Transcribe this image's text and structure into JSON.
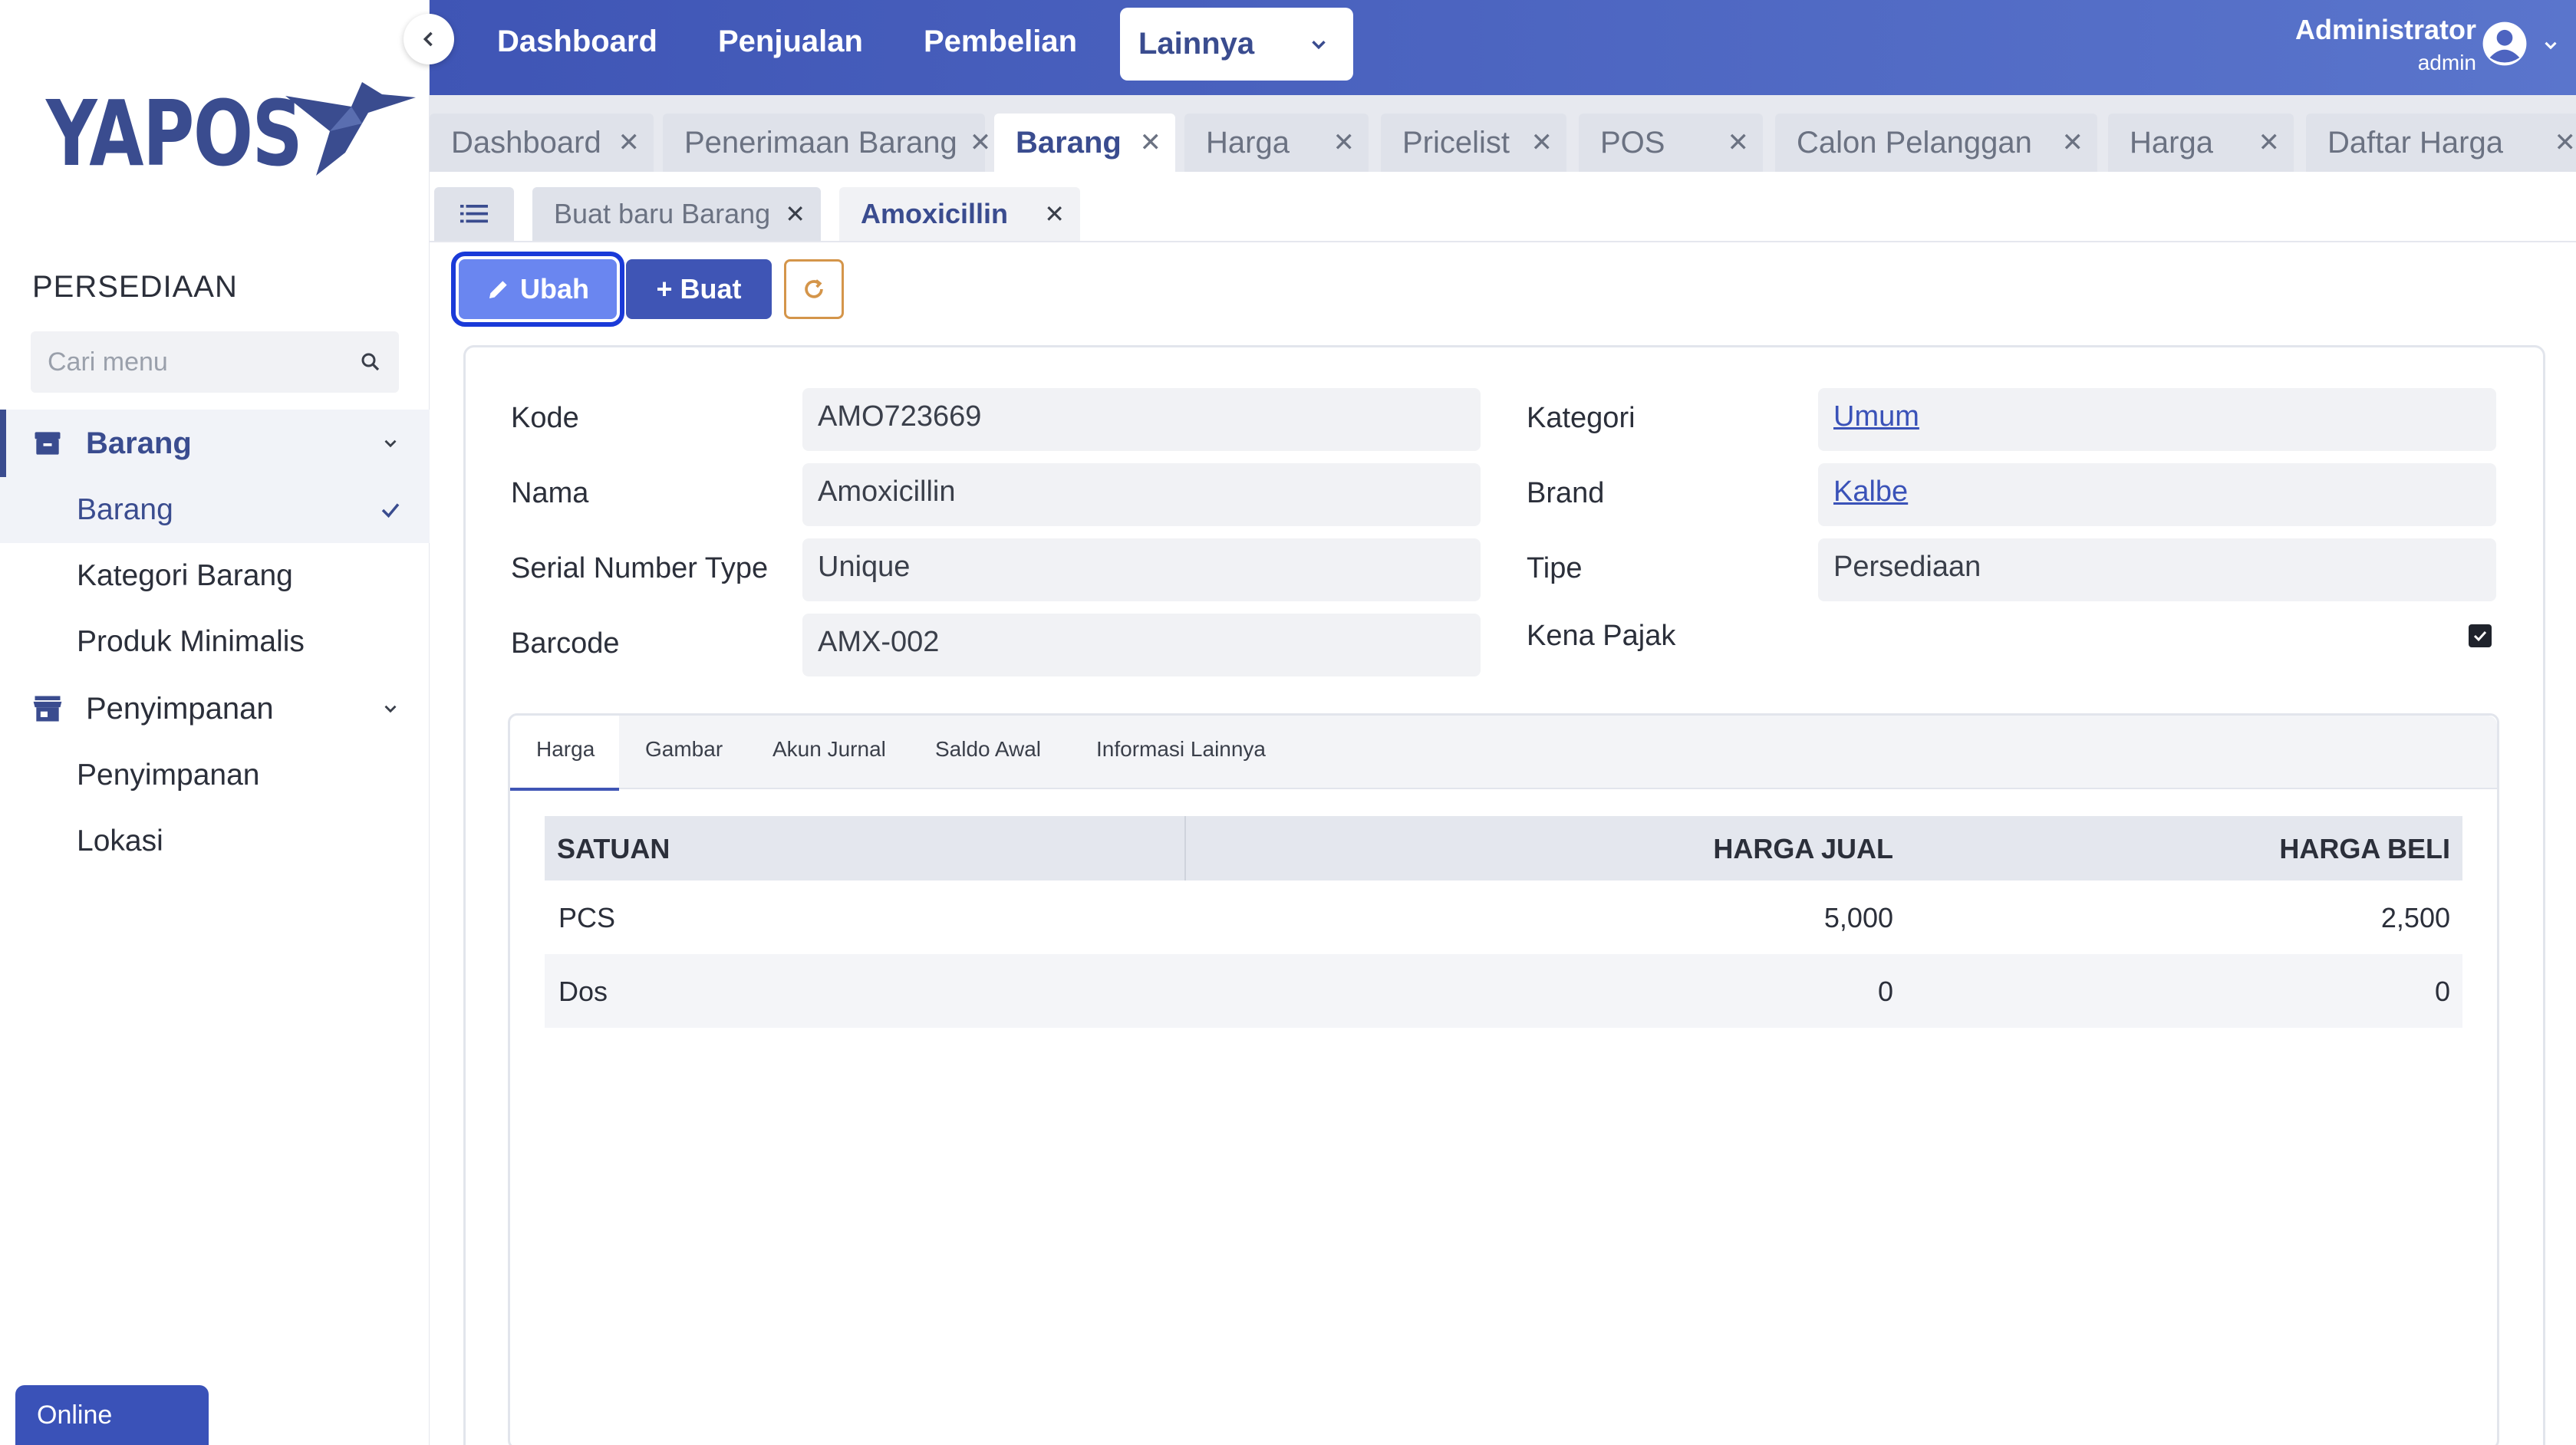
{
  "brand": {
    "name": "YAPOS",
    "color": "#3a4c8f"
  },
  "sidebar": {
    "section_title": "PERSEDIAAN",
    "search_placeholder": "Cari menu",
    "groups": [
      {
        "label": "Barang",
        "icon": "archive-icon",
        "items": [
          "Barang",
          "Kategori Barang",
          "Produk Minimalis"
        ]
      },
      {
        "label": "Penyimpanan",
        "icon": "store-icon",
        "items": [
          "Penyimpanan",
          "Lokasi"
        ]
      }
    ],
    "status": "Online"
  },
  "topnav": {
    "items": [
      "Dashboard",
      "Penjualan",
      "Pembelian"
    ],
    "dropdown": "Lainnya",
    "user_name": "Administrator",
    "user_role": "admin"
  },
  "tabs": [
    "Dashboard",
    "Penerimaan Barang",
    "Barang",
    "Harga",
    "Pricelist",
    "POS",
    "Calon Pelanggan",
    "Harga",
    "Daftar Harga"
  ],
  "subtabs": [
    "Buat baru Barang",
    "Amoxicillin"
  ],
  "actions": {
    "edit": "Ubah",
    "create": "+ Buat"
  },
  "form": {
    "kode": {
      "label": "Kode",
      "value": "AMO723669"
    },
    "nama": {
      "label": "Nama",
      "value": "Amoxicillin"
    },
    "serial": {
      "label": "Serial Number Type",
      "value": "Unique"
    },
    "barcode": {
      "label": "Barcode",
      "value": "AMX-002"
    },
    "kategori": {
      "label": "Kategori",
      "value": "Umum"
    },
    "brand": {
      "label": "Brand",
      "value": "Kalbe"
    },
    "tipe": {
      "label": "Tipe",
      "value": "Persediaan"
    },
    "pajak": {
      "label": "Kena Pajak",
      "checked": true
    }
  },
  "detail_tabs": [
    "Harga",
    "Gambar",
    "Akun Jurnal",
    "Saldo Awal",
    "Informasi Lainnya"
  ],
  "price_table": {
    "headers": [
      "SATUAN",
      "HARGA JUAL",
      "HARGA BELI"
    ],
    "rows": [
      {
        "satuan": "PCS",
        "jual": "5,000",
        "beli": "2,500"
      },
      {
        "satuan": "Dos",
        "jual": "0",
        "beli": "0"
      }
    ]
  }
}
